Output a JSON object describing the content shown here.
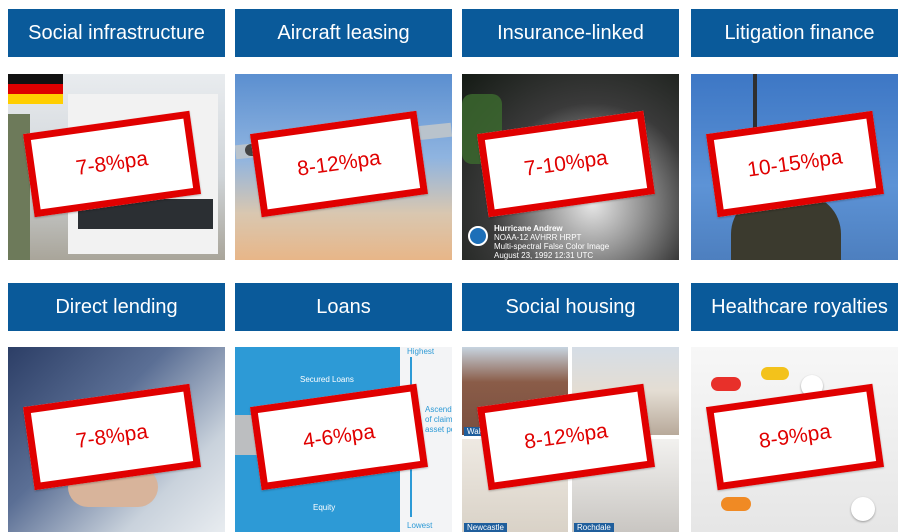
{
  "rows": [
    {
      "tiles": [
        {
          "title": "Social infrastructure",
          "rate": "7-8%pa",
          "image": "office-building-with-german-flag"
        },
        {
          "title": "Aircraft leasing",
          "rate": "8-12%pa",
          "image": "aircraft-in-sky"
        },
        {
          "title": "Insurance-linked",
          "rate": "7-10%pa",
          "image": "hurricane-satellite"
        },
        {
          "title": "Litigation finance",
          "rate": "10-15%pa",
          "image": "justice-statue"
        }
      ]
    },
    {
      "tiles": [
        {
          "title": "Direct lending",
          "rate": "7-8%pa",
          "image": "handshake"
        },
        {
          "title": "Loans",
          "rate": "4-6%pa",
          "image": "capital-structure-diagram"
        },
        {
          "title": "Social housing",
          "rate": "8-12%pa",
          "image": "housing-collage"
        },
        {
          "title": "Healthcare royalties",
          "rate": "8-9%pa",
          "image": "pills"
        }
      ]
    }
  ],
  "photo_text": {
    "hurricane": {
      "line1": "Hurricane Andrew",
      "line2": "NOAA-12 AVHRR HRPT",
      "line3": "Multi-spectral False Color Image",
      "line4": "August 23, 1992 12:31 UTC"
    },
    "loans": {
      "secured": "Secured Loans",
      "equity": "Equity",
      "highest": "Highest",
      "lowest": "Lowest",
      "side1": "Ascending",
      "side2": "of claims on",
      "side3": "asset pool"
    },
    "housing": {
      "label1": "Wakefield",
      "label2": "Newcastle",
      "label3": "Rochdale"
    }
  },
  "colors": {
    "header_bg": "#0a5a9a",
    "stamp_red": "#e00000"
  }
}
